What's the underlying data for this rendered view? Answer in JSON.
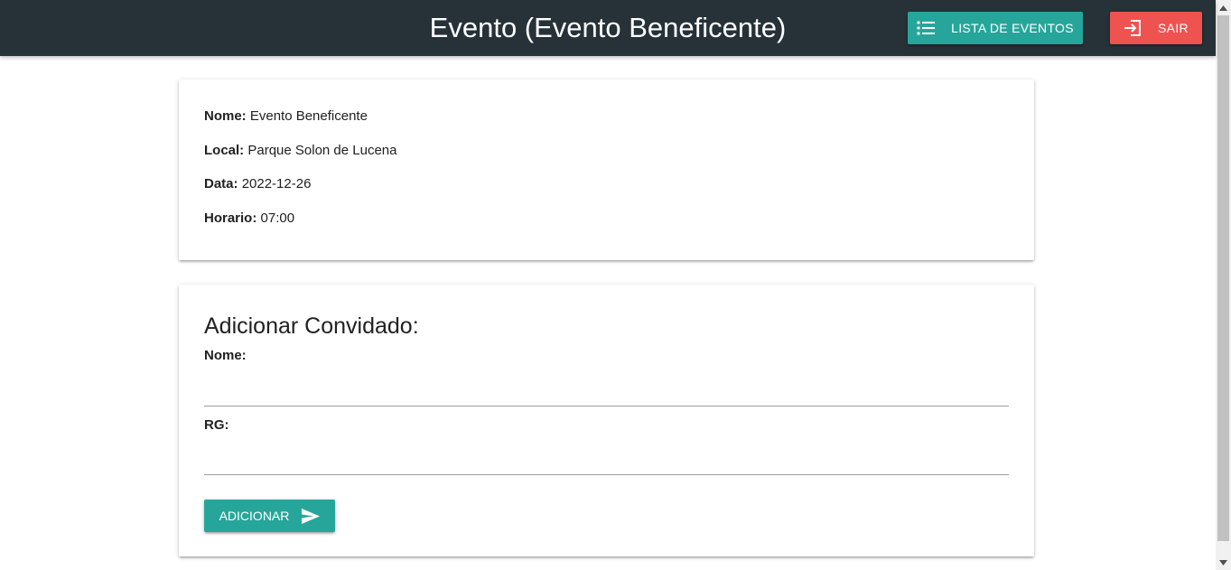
{
  "header": {
    "title": "Evento (Evento Beneficente)",
    "list_button": {
      "label": "LISTA DE EVENTOS",
      "icon": "list-icon"
    },
    "exit_button": {
      "label": "SAIR",
      "icon": "exit-icon"
    }
  },
  "event": {
    "name_label": "Nome:",
    "name_value": "Evento Beneficente",
    "local_label": "Local:",
    "local_value": "Parque Solon de Lucena",
    "date_label": "Data:",
    "date_value": "2022-12-26",
    "time_label": "Horario:",
    "time_value": "07:00"
  },
  "guest_form": {
    "title": "Adicionar Convidado:",
    "name_label": "Nome:",
    "name_value": "",
    "rg_label": "RG:",
    "rg_value": "",
    "submit": {
      "label": "ADICIONAR",
      "icon": "send-icon"
    }
  },
  "colors": {
    "header_bg": "#263238",
    "primary": "#26a69a",
    "danger": "#ef5350"
  }
}
